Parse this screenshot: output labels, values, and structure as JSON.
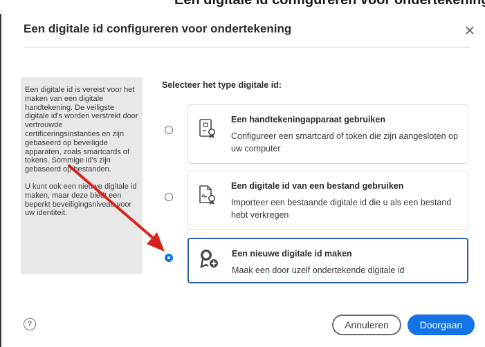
{
  "background_heading": "Een digitale id configureren voor ondertekening",
  "dialog": {
    "title": "Een digitale id configureren voor ondertekening",
    "close_glyph": "×"
  },
  "help_panel": {
    "paragraph1": "Een digitale id is vereist voor het maken van een digitale handtekening. De veiligste digitale id's worden verstrekt door vertrouwde certificeringsinstanties en zijn gebaseerd op beveiligde apparaten, zoals smartcards of tokens. Sommige id's zijn gebaseerd op bestanden.",
    "paragraph2": "U kunt ook een nieuwe digitale id maken, maar deze biedt een beperkt beveiligingsniveau voor uw identiteit."
  },
  "section_label": "Selecteer het type digitale id:",
  "options": [
    {
      "title": "Een handtekeningapparaat gebruiken",
      "description": "Configureer een smartcard of token die zijn aangesloten op uw computer",
      "icon": "smartcard-certificate-icon",
      "selected": false
    },
    {
      "title": "Een digitale id van een bestand gebruiken",
      "description": "Importeer een bestaande digitale id die u als een bestand hebt verkregen",
      "icon": "file-certificate-icon",
      "selected": false
    },
    {
      "title": "Een nieuwe digitale id maken",
      "description": "Maak een door uzelf ondertekende digitale id",
      "icon": "new-certificate-icon",
      "selected": true
    }
  ],
  "footer": {
    "help_glyph": "?",
    "cancel_label": "Annuleren",
    "continue_label": "Doorgaan"
  },
  "colors": {
    "accent": "#1473e6",
    "selected_border": "#2f5fa7",
    "annotation_arrow": "#d9221c",
    "panel_bg": "#e8e8e8"
  }
}
